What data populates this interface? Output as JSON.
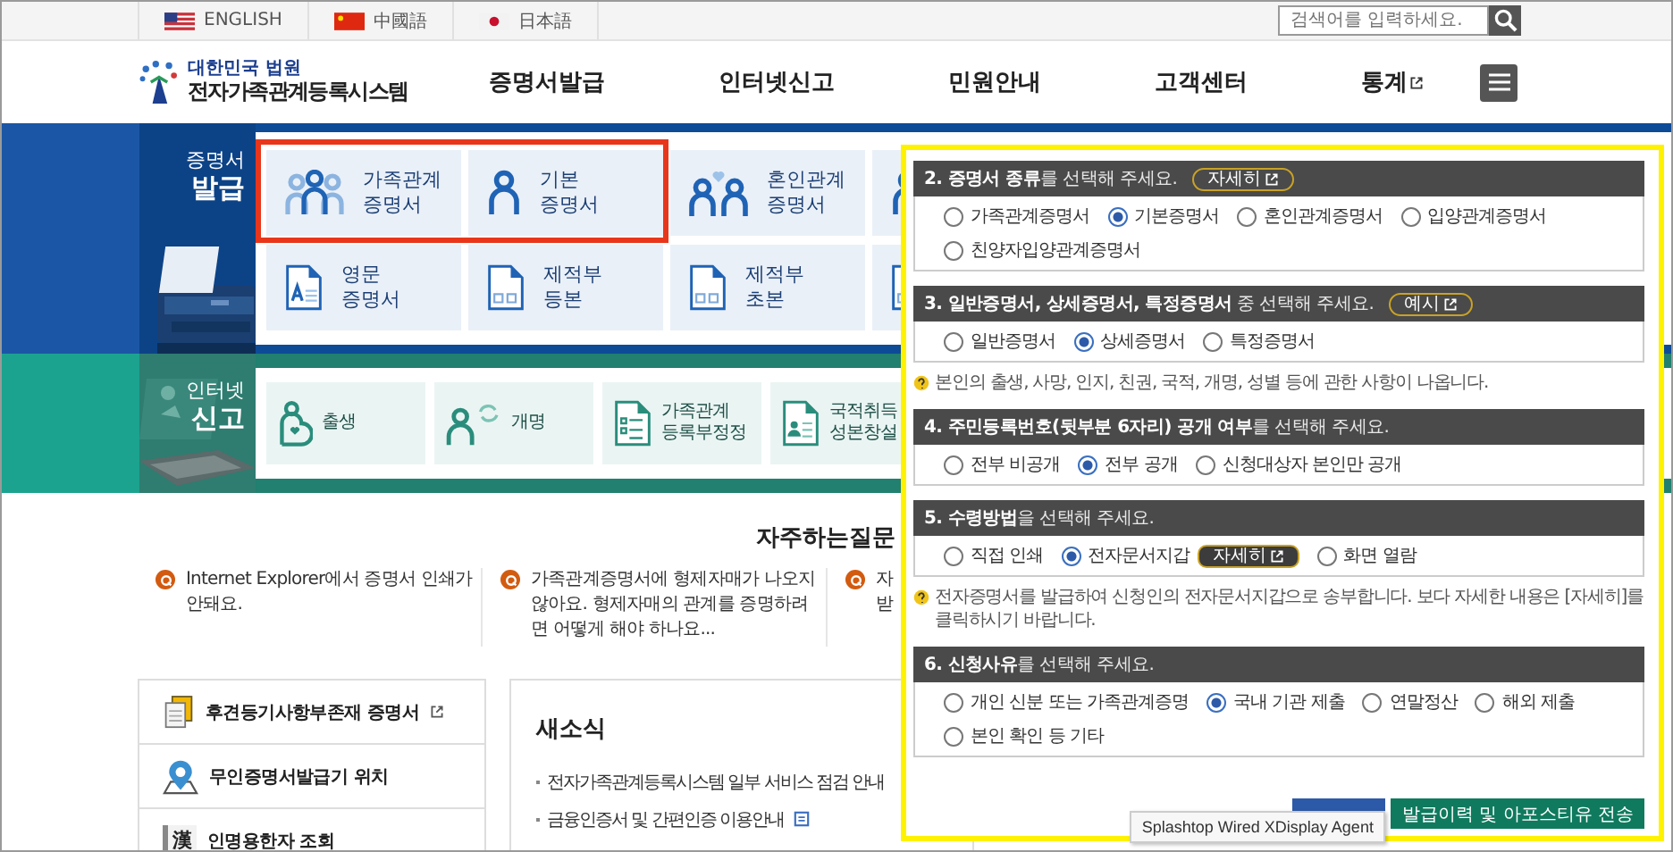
{
  "top_bar": {
    "languages": [
      {
        "label": "ENGLISH",
        "kind": "us"
      },
      {
        "label": "中國語",
        "kind": "cn"
      },
      {
        "label": "日本語",
        "kind": "jp"
      }
    ],
    "search": {
      "placeholder": "검색어를 입력하세요."
    }
  },
  "header": {
    "logo": {
      "org": "대한민국 법원",
      "name": "전자가족관계등록시스템"
    },
    "nav": [
      {
        "label": "증명서발급",
        "external": false
      },
      {
        "label": "인터넷신고",
        "external": false
      },
      {
        "label": "민원안내",
        "external": false
      },
      {
        "label": "고객센터",
        "external": false
      },
      {
        "label": "통계",
        "external": true
      }
    ]
  },
  "issue_band": {
    "title_lines": [
      "증명서",
      "발급"
    ],
    "tiles": [
      {
        "lines": [
          "가족관계",
          "증명서"
        ],
        "kind": "family",
        "highlighted": true
      },
      {
        "lines": [
          "기본",
          "증명서"
        ],
        "kind": "person",
        "highlighted": true
      },
      {
        "lines": [
          "혼인관계",
          "증명서"
        ],
        "kind": "couple",
        "highlighted": false
      },
      {
        "kind": "person",
        "highlighted": false
      },
      {
        "lines": [
          "영문",
          "증명서"
        ],
        "kind": "doc-a",
        "highlighted": false
      },
      {
        "lines": [
          "제적부",
          "등본"
        ],
        "kind": "doc-old",
        "highlighted": false
      },
      {
        "lines": [
          "제적부",
          "초본"
        ],
        "kind": "doc-old",
        "highlighted": false
      },
      {
        "kind": "doc",
        "highlighted": false
      }
    ]
  },
  "report_band": {
    "title_lines": [
      "인터넷",
      "신고"
    ],
    "tiles": [
      {
        "lines": [
          "출생"
        ],
        "kind": "baby"
      },
      {
        "lines": [
          "개명"
        ],
        "kind": "rename"
      },
      {
        "lines": [
          "가족관계",
          "등록부정정"
        ],
        "kind": "form"
      },
      {
        "lines": [
          "국적취득",
          "성본창설"
        ],
        "kind": "id-card"
      }
    ]
  },
  "faq": {
    "title": "자주하는질문",
    "items": [
      {
        "lines": [
          "Internet Explorer에서 증명서 인쇄가",
          "안돼요."
        ]
      },
      {
        "lines": [
          "가족관계증명서에 형제자매가 나오지",
          "않아요. 형제자매의 관계를 증명하려",
          "면 어떻게 해야 하나요..."
        ]
      },
      {
        "lines": [
          "자",
          "받"
        ]
      }
    ]
  },
  "quick_links": [
    {
      "label": "후견등기사항부존재 증명서",
      "kind": "document",
      "external": true
    },
    {
      "label": "무인증명서발급기 위치",
      "kind": "map-pin",
      "external": false
    },
    {
      "label": "인명용한자 조회",
      "kind": "hanja",
      "glyph": "漢",
      "external": false
    }
  ],
  "news": {
    "title": "새소식",
    "items": [
      {
        "text": "전자가족관계등록시스템 일부 서비스 점검 안내",
        "attachment": false
      },
      {
        "text": "금융인증서 및 간편인증 이용안내",
        "attachment": true
      }
    ]
  },
  "form": {
    "sections": [
      {
        "title": "**2. 증명서 종류**를 선택해 주세요.",
        "button": "자세히",
        "options": [
          {
            "label": "가족관계증명서",
            "selected": false
          },
          {
            "label": "기본증명서",
            "selected": true
          },
          {
            "label": "혼인관계증명서",
            "selected": false
          },
          {
            "label": "입양관계증명서",
            "selected": false
          },
          {
            "label": "친양자입양관계증명서",
            "selected": false
          }
        ]
      },
      {
        "title": "**3. 일반증명서, 상세증명서, 특정증명서** 중 선택해 주세요.",
        "button": "예시",
        "options": [
          {
            "label": "일반증명서",
            "selected": false
          },
          {
            "label": "상세증명서",
            "selected": true
          },
          {
            "label": "특정증명서",
            "selected": false
          }
        ],
        "note": "본인의 출생, 사망, 인지, 친권, 국적, 개명, 성별 등에 관한 사항이 나옵니다."
      },
      {
        "title": "**4. 주민등록번호(뒷부분 6자리) 공개 여부**를 선택해 주세요.",
        "options": [
          {
            "label": "전부 비공개",
            "selected": false
          },
          {
            "label": "전부 공개",
            "selected": true
          },
          {
            "label": "신청대상자 본인만 공개",
            "selected": false
          }
        ]
      },
      {
        "title": "**5. 수령방법**을 선택해 주세요.",
        "options": [
          {
            "label": "직접 인쇄",
            "selected": false
          },
          {
            "label": "전자문서지갑",
            "selected": true,
            "button": "자세히"
          },
          {
            "label": "화면 열람",
            "selected": false
          }
        ],
        "note": "전자증명서를 발급하여 신청인의 전자문서지갑으로 송부합니다. 보다 자세한 내용은 [자세히]를 클릭하시기 바랍니다."
      },
      {
        "title": "**6. 신청사유**를 선택해 주세요.",
        "options": [
          {
            "label": "개인 신분 또는 가족관계증명",
            "selected": false
          },
          {
            "label": "국내 기관 제출",
            "selected": true
          },
          {
            "label": "연말정산",
            "selected": false
          },
          {
            "label": "해외 제출",
            "selected": false
          },
          {
            "label": "본인 확인 등 기타",
            "selected": false
          }
        ]
      }
    ],
    "buttons": [
      {
        "color": "#2d5aa8"
      },
      {
        "label": "발급이력 및 아포스티유 전송",
        "color": "#0f7a5e"
      }
    ],
    "tooltip": "Splashtop Wired XDisplay Agent"
  }
}
